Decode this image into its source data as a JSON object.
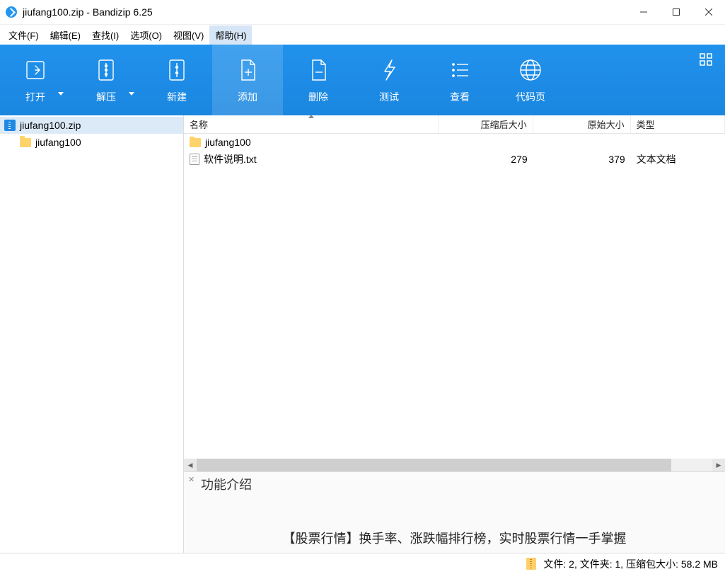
{
  "titlebar": {
    "title": "jiufang100.zip - Bandizip 6.25"
  },
  "menu": {
    "file": "文件(F)",
    "edit": "编辑(E)",
    "find": "查找(I)",
    "options": "选项(O)",
    "view": "视图(V)",
    "help": "帮助(H)"
  },
  "toolbar": {
    "open": "打开",
    "extract": "解压",
    "new": "新建",
    "add": "添加",
    "delete": "删除",
    "test": "测试",
    "view": "查看",
    "codepage": "代码页"
  },
  "tree": {
    "root": "jiufang100.zip",
    "child": "jiufang100"
  },
  "columns": {
    "name": "名称",
    "compressed": "压缩后大小",
    "original": "原始大小",
    "type": "类型"
  },
  "rows": [
    {
      "icon": "folder",
      "name": "jiufang100",
      "compressed": "",
      "original": "",
      "type": ""
    },
    {
      "icon": "txt",
      "name": "软件说明.txt",
      "compressed": "279",
      "original": "379",
      "type": "文本文档"
    }
  ],
  "info": {
    "title": "功能介绍",
    "msg": "【股票行情】换手率、涨跌幅排行榜，实时股票行情一手掌握"
  },
  "status": {
    "text": "文件: 2, 文件夹: 1, 压缩包大小: 58.2 MB"
  }
}
